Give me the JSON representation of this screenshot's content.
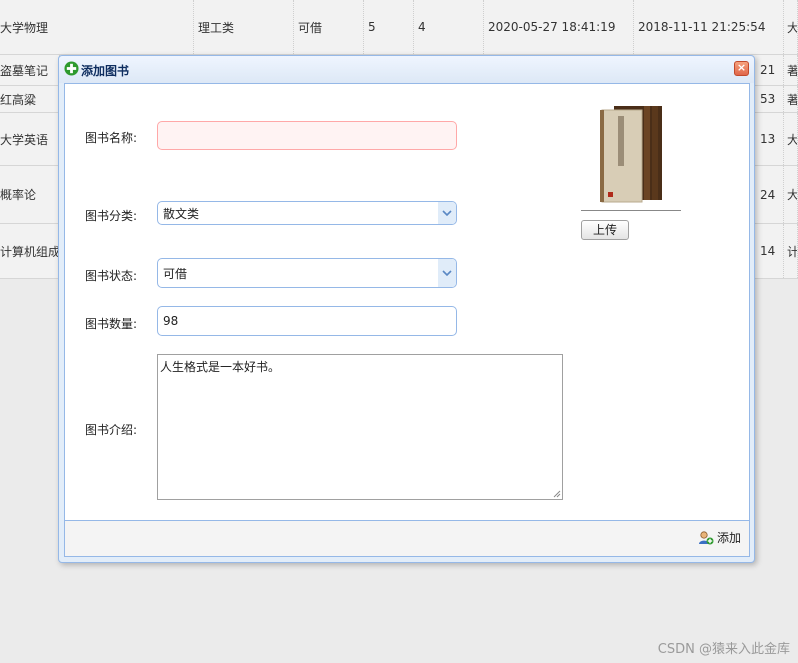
{
  "background_table": {
    "rows": [
      [
        "大学物理",
        "理工类",
        "可借",
        "5",
        "4",
        "2020-05-27 18:41:19",
        "2018-11-11 21:25:54",
        "大"
      ],
      [
        "盗墓笔记",
        "",
        "",
        "",
        "",
        "",
        "21",
        "著"
      ],
      [
        "红高粱",
        "",
        "",
        "",
        "",
        "",
        "53",
        "著"
      ],
      [
        "大学英语",
        "",
        "",
        "",
        "",
        "",
        "13",
        "大"
      ],
      [
        "概率论",
        "",
        "",
        "",
        "",
        "",
        "24",
        "大"
      ],
      [
        "计算机组成",
        "",
        "",
        "",
        "",
        "",
        "14",
        "计"
      ]
    ]
  },
  "dialog": {
    "title": "添加图书",
    "close_symbol": "×",
    "form": {
      "name_label": "图书名称:",
      "name_value": "",
      "category_label": "图书分类:",
      "category_value": "散文类",
      "status_label": "图书状态:",
      "status_value": "可借",
      "quantity_label": "图书数量:",
      "quantity_value": "98",
      "intro_label": "图书介绍:",
      "intro_value": "人生格式是一本好书。"
    },
    "upload_label": "上传",
    "add_label": "添加"
  },
  "watermark": "CSDN @猿来入此金库",
  "icons": {
    "title": "plus-circle-icon",
    "add": "user-add-icon",
    "close": "close-icon",
    "combo": "chevron-down-icon"
  },
  "colors": {
    "dialog_border": "#95b8e7",
    "invalid_border": "#ffa8a8",
    "close_button": "#e0664a"
  }
}
